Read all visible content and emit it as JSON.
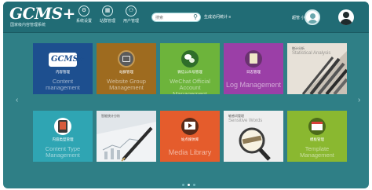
{
  "brand": {
    "name": "GCMS+",
    "subtitle": "国家级内容管理系统",
    "brand_color": "#216c75"
  },
  "nav": [
    {
      "label": "系统设置",
      "icon": "gear-icon"
    },
    {
      "label": "站群管理",
      "icon": "grid-icon"
    },
    {
      "label": "用户管理",
      "icon": "users-icon"
    }
  ],
  "search": {
    "placeholder": "搜索",
    "icon": "search-icon"
  },
  "header_link": "生成访问统计 ≡",
  "user": {
    "name": "超管 小林"
  },
  "tiles": [
    {
      "zh": "内容管理",
      "en": "Content management",
      "color": "#1d4f8f",
      "icon": "gcms-logo"
    },
    {
      "zh": "站群管理",
      "en": "Website Group Management",
      "color": "#9e6b1f",
      "icon": "window-icon"
    },
    {
      "zh": "微信公众号管理",
      "en": "WeChat Official Account Management",
      "color": "#6db43b",
      "icon": "wechat-icon"
    },
    {
      "zh": "日志管理",
      "en": "Log Management",
      "color": "#9b3fa7",
      "icon": "notepad-icon"
    },
    {
      "zh": "统计分析",
      "en": "Statistical Analysis",
      "color": "#d9cfc4",
      "icon": "pencils-photo"
    },
    {
      "zh": "内容类型管理",
      "en": "Content Type Management",
      "color": "#2fa5b3",
      "icon": "tablet-icon"
    },
    {
      "zh": "智能统计分析",
      "en": "",
      "color": "#cfd6dc",
      "icon": "pen-chart-photo"
    },
    {
      "zh": "站点媒体库",
      "en": "Media Library",
      "color": "#e55c2c",
      "icon": "film-icon"
    },
    {
      "zh": "敏感词管理",
      "en": "Sensitive Words",
      "color": "#e8e8e8",
      "icon": "magnifier-photo"
    },
    {
      "zh": "模板管理",
      "en": "Template Management",
      "color": "#8ab830",
      "icon": "browser-icon"
    }
  ],
  "carousel": {
    "pages": 3,
    "active": 2
  }
}
